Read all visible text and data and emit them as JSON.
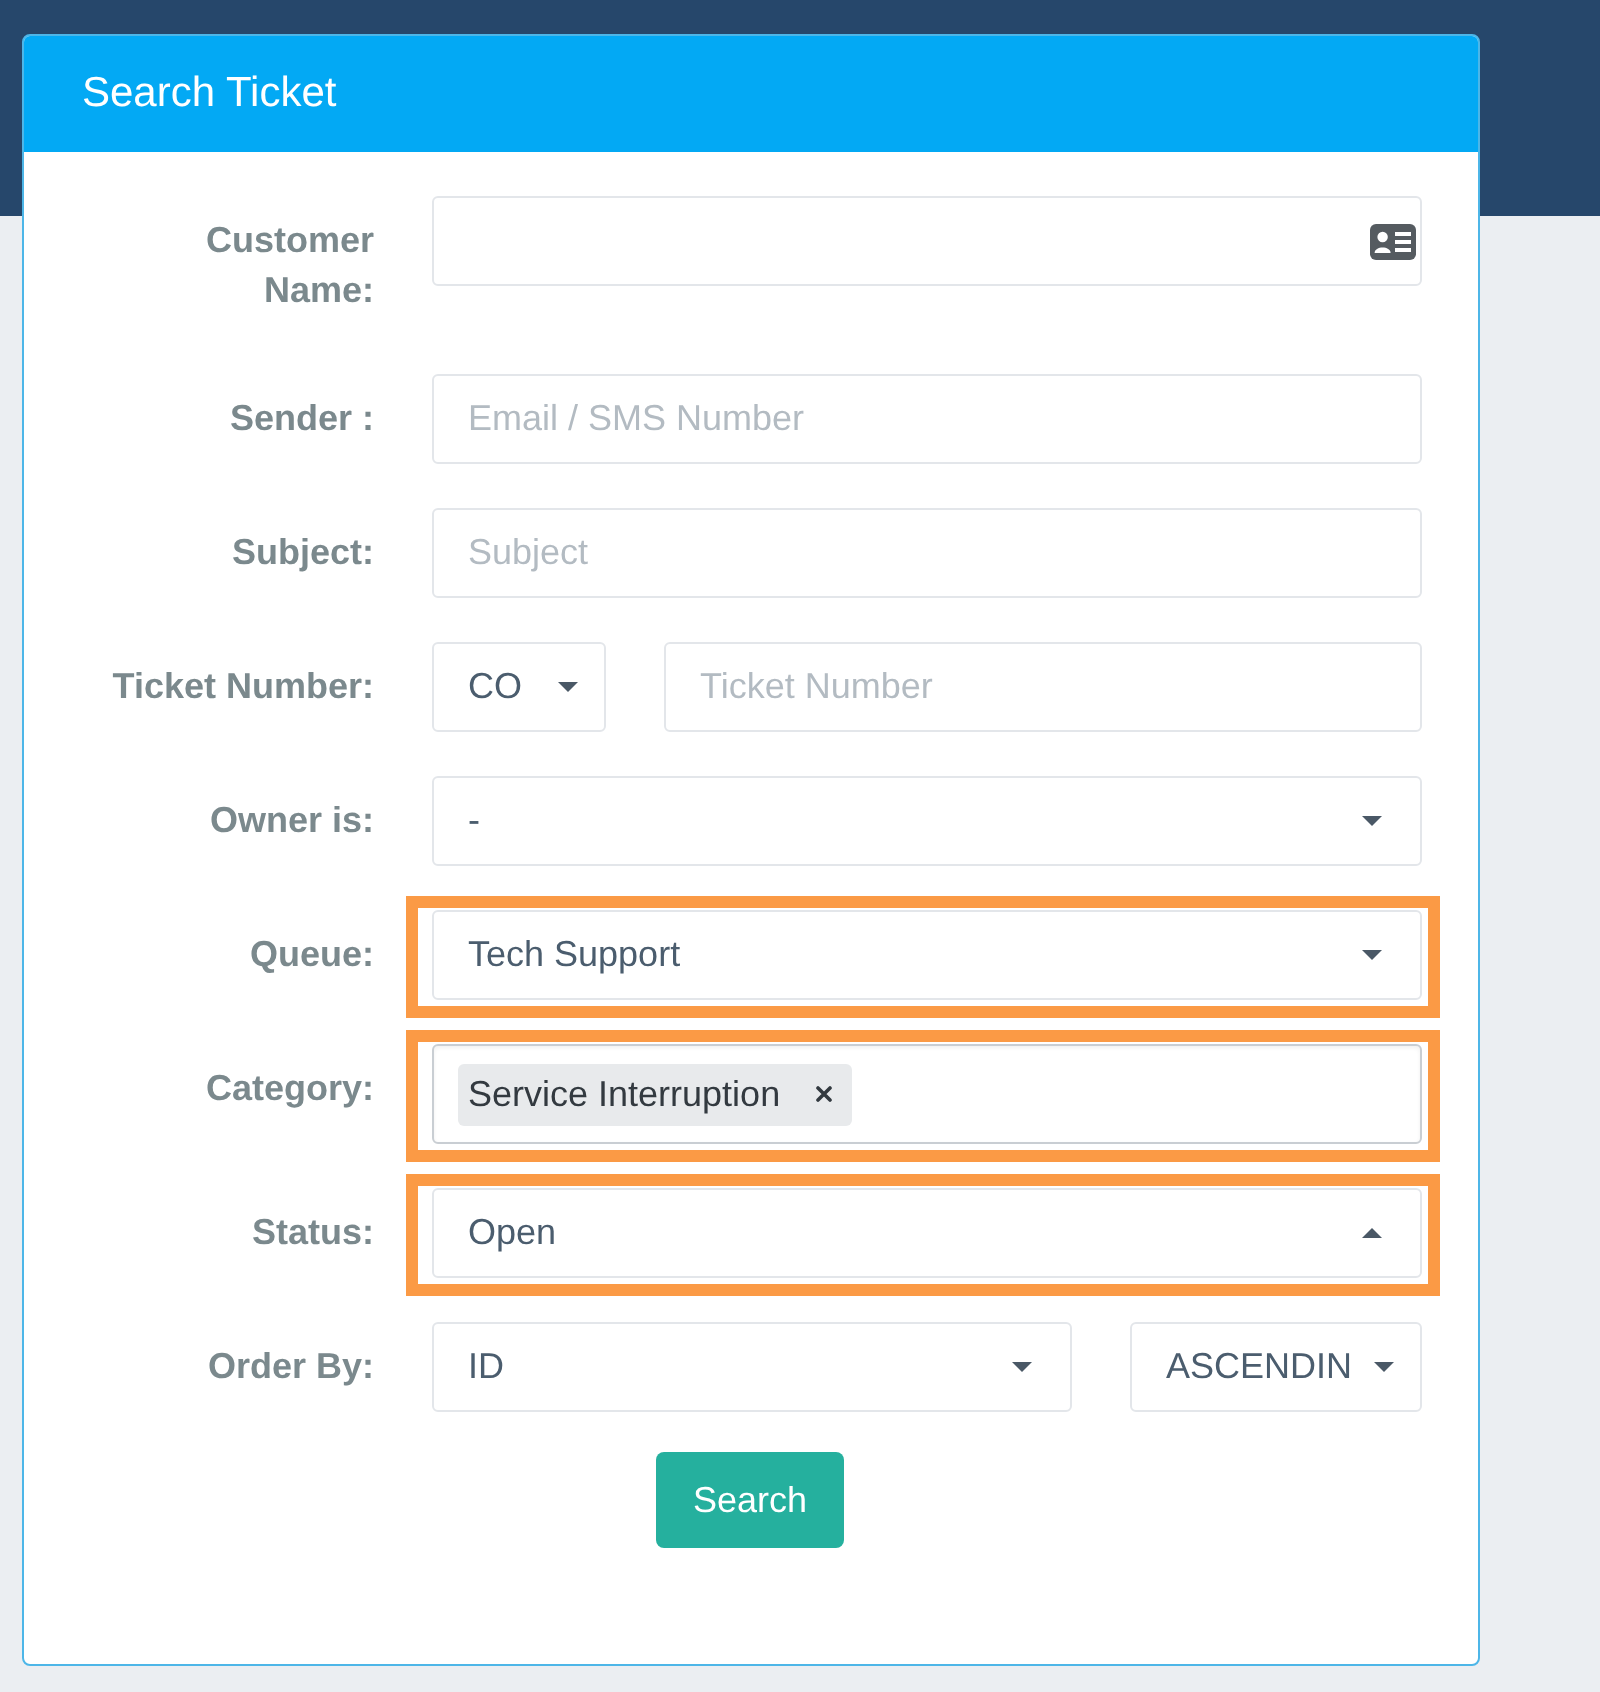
{
  "panel": {
    "title": "Search Ticket"
  },
  "fields": [
    {
      "kind": "lookup",
      "label": "Customer Name:",
      "highlighted": false
    },
    {
      "kind": "text",
      "label": "Sender :",
      "placeholder": "Email / SMS Number",
      "highlighted": false
    },
    {
      "kind": "text",
      "label": "Subject:",
      "placeholder": "Subject",
      "highlighted": false
    },
    {
      "kind": "prefixed",
      "label": "Ticket Number:",
      "prefix": {
        "value": "CO",
        "expanded": false
      },
      "placeholder": "Ticket Number",
      "highlighted": false
    },
    {
      "kind": "select",
      "label": "Owner is:",
      "value": "-",
      "expanded": false,
      "highlighted": false
    },
    {
      "kind": "select",
      "label": "Queue:",
      "value": "Tech Support",
      "expanded": false,
      "highlighted": true
    },
    {
      "kind": "tags",
      "label": "Category:",
      "tags": [
        "Service Interruption"
      ],
      "highlighted": true
    },
    {
      "kind": "select",
      "label": "Status:",
      "value": "Open",
      "expanded": true,
      "highlighted": true
    },
    {
      "kind": "order",
      "label": "Order By:",
      "sort_field": {
        "value": "ID",
        "expanded": false
      },
      "direction": {
        "value": "ASCENDIN",
        "expanded": false
      },
      "highlighted": false
    }
  ],
  "search_button": "Search"
}
